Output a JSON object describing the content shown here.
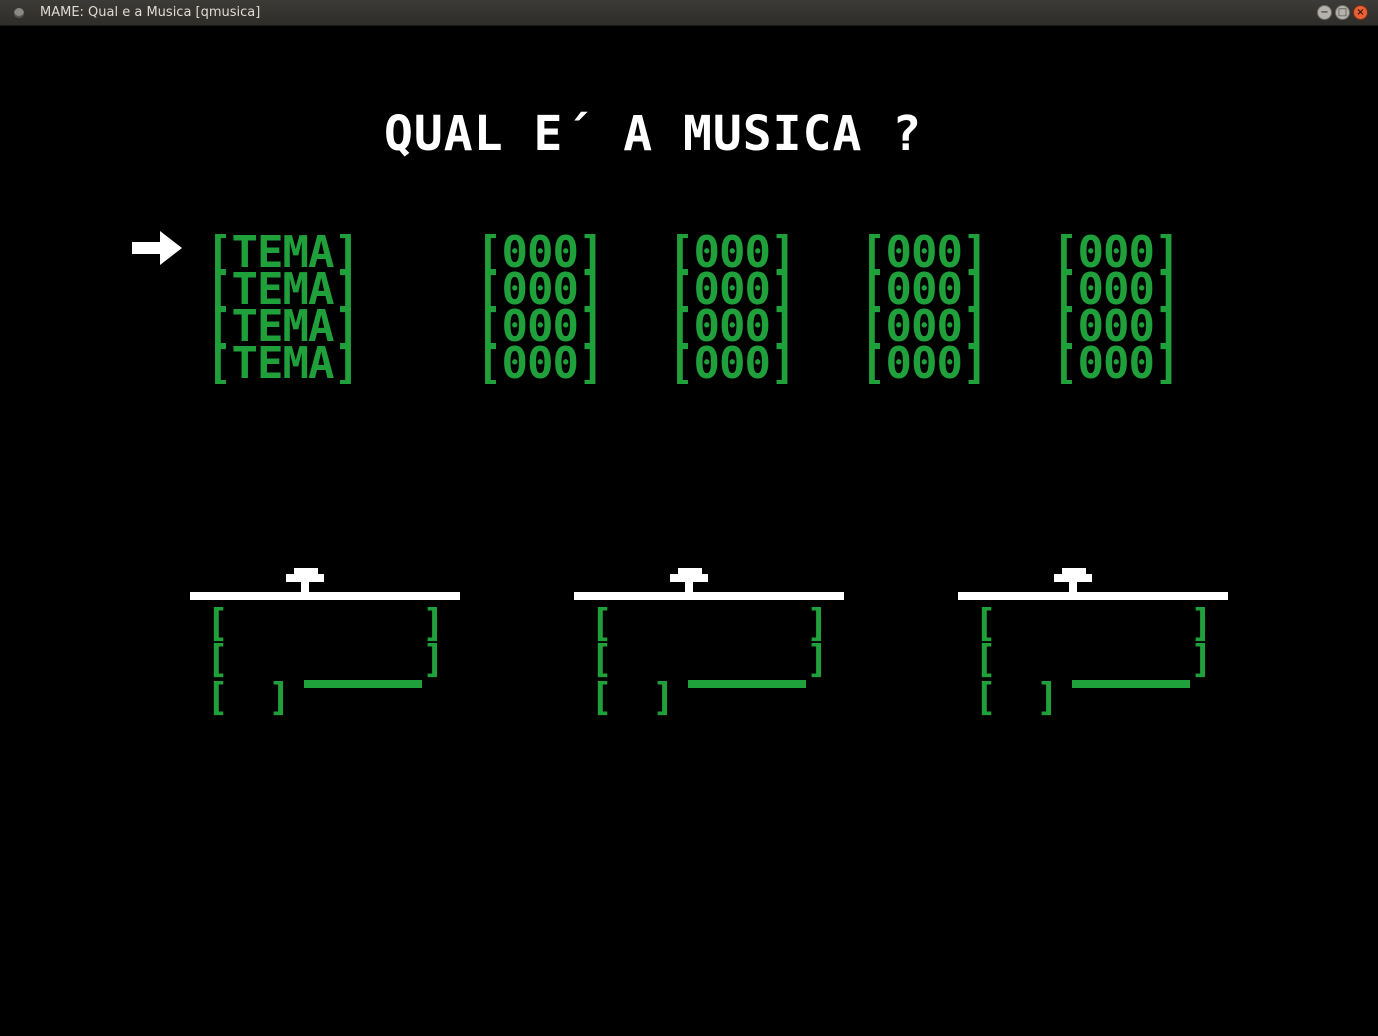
{
  "window": {
    "title": "MAME: Qual e a Musica [qmusica]",
    "buttons": {
      "minimize": "−",
      "maximize": "□",
      "close": "×"
    }
  },
  "game": {
    "title": "QUAL E´ A MUSICA ?",
    "selector_icon": "right-arrow-icon",
    "rows": [
      {
        "theme": "[TEMA]",
        "scores": [
          "[000]",
          "[000]",
          "[000]",
          "[000]"
        ]
      },
      {
        "theme": "[TEMA]",
        "scores": [
          "[000]",
          "[000]",
          "[000]",
          "[000]"
        ]
      },
      {
        "theme": "[TEMA]",
        "scores": [
          "[000]",
          "[000]",
          "[000]",
          "[000]"
        ]
      },
      {
        "theme": "[TEMA]",
        "scores": [
          "[000]",
          "[000]",
          "[000]",
          "[000]"
        ]
      }
    ],
    "podium_count": 3,
    "colors": {
      "background": "#000000",
      "text_primary": "#ffffff",
      "text_green": "#1fa03b"
    }
  }
}
